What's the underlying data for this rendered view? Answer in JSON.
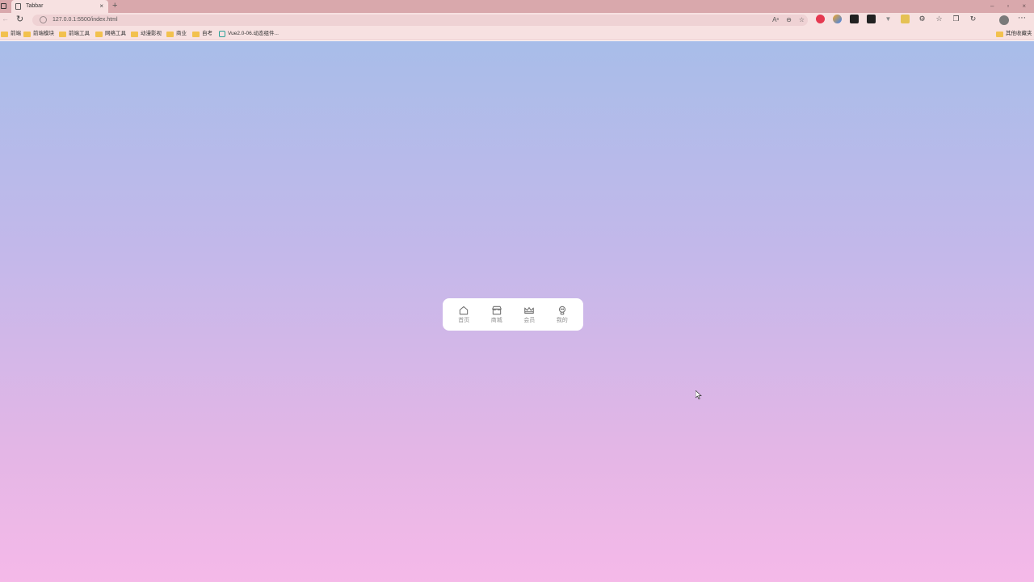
{
  "browser": {
    "tab_title": "Tabbar",
    "tab_close": "×",
    "new_tab": "+",
    "window_controls": [
      "–",
      "▫",
      "×"
    ],
    "url": "127.0.0.1:5500/index.html",
    "omnibox_icons": [
      "Aˢ",
      "⊖",
      "☆"
    ],
    "bookmarks": [
      {
        "label": "前端",
        "icon": "folder-icon"
      },
      {
        "label": "前端模块",
        "icon": "folder-icon"
      },
      {
        "label": "前端工具",
        "icon": "folder-icon"
      },
      {
        "label": "网络工具",
        "icon": "folder-icon"
      },
      {
        "label": "动漫影视",
        "icon": "folder-icon"
      },
      {
        "label": "商业",
        "icon": "folder-icon"
      },
      {
        "label": "自考",
        "icon": "folder-icon"
      },
      {
        "label": "Vue2.0-06.动态组件...",
        "icon": "page-icon"
      }
    ],
    "other_bookmarks": "其他收藏夹"
  },
  "tabbar": {
    "items": [
      {
        "label": "首页",
        "icon": "home-icon"
      },
      {
        "label": "商城",
        "icon": "store-icon"
      },
      {
        "label": "会员",
        "icon": "crown-icon"
      },
      {
        "label": "我的",
        "icon": "user-icon"
      }
    ]
  },
  "colors": {
    "background_top": "#a8bde9",
    "background_bottom": "#f5b9e8",
    "tabbar_bg": "#ffffff",
    "tab_label": "#8f8f8f"
  }
}
